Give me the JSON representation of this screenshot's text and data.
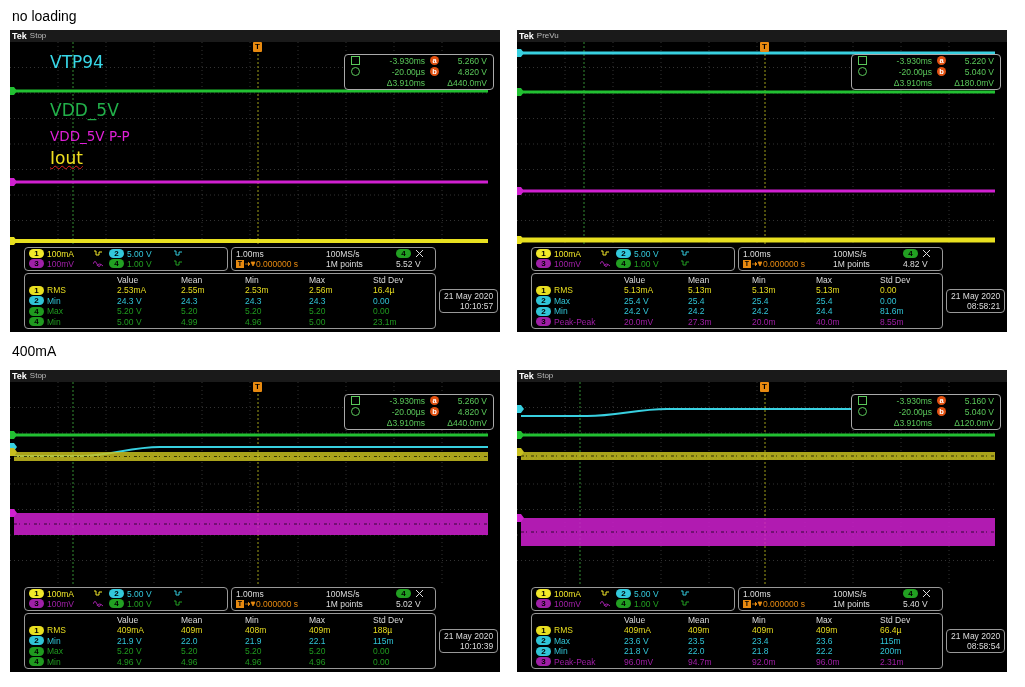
{
  "sections": [
    {
      "heading": "no loading",
      "scopes": [
        {
          "brand": "Tek",
          "status": "Stop",
          "trigger_marker": "T",
          "annotations": [
            {
              "text": "VTP94",
              "color": "#38d6e6",
              "spellcheck": false
            },
            {
              "text": "VDD_5V",
              "color": "#22b04a",
              "spellcheck": false
            },
            {
              "text": "VDD_5V P-P",
              "color": "#e020d8",
              "spellcheck": false
            },
            {
              "text": "Iout",
              "color": "#f0e020",
              "spellcheck": true
            }
          ],
          "cursors": {
            "a_time": "-3.930ms",
            "a_label": "a",
            "a_value": "5.260 V",
            "b_time": "-20.00µs",
            "b_label": "b",
            "b_value": "4.820 V",
            "delta_time": "Δ3.910ms",
            "delta_value": "Δ440.0mV"
          },
          "channels": [
            {
              "number": "1",
              "scale": "100mA",
              "color": "#f2e82a"
            },
            {
              "number": "2",
              "scale": "5.00 V",
              "color": "#33c9dc"
            },
            {
              "number": "3",
              "scale": "100mV",
              "color": "#a020a8"
            },
            {
              "number": "4",
              "scale": "1.00 V",
              "color": "#22a022"
            }
          ],
          "horizontal": {
            "scale": "1.00ms",
            "sample_rate": "100MS/s",
            "trigger_badge": "T",
            "trigger_position": "0.000000 s",
            "record_length": "1M points",
            "trigger_source": "4",
            "trigger_level": "5.52 V"
          },
          "measurements": {
            "columns": [
              "Value",
              "Mean",
              "Min",
              "Max",
              "Std Dev"
            ],
            "rows": [
              {
                "channel": "1",
                "color": "#e8de20",
                "type": "RMS",
                "cells": [
                  "2.53mA",
                  "2.55m",
                  "2.53m",
                  "2.56m",
                  "16.4µ"
                ]
              },
              {
                "channel": "2",
                "color": "#30c4d6",
                "type": "Min",
                "cells": [
                  "24.3 V",
                  "24.3",
                  "24.3",
                  "24.3",
                  "0.00"
                ]
              },
              {
                "channel": "4",
                "color": "#1f9a1f",
                "type": "Max",
                "cells": [
                  "5.20 V",
                  "5.20",
                  "5.20",
                  "5.20",
                  "0.00"
                ]
              },
              {
                "channel": "4",
                "color": "#1f9a1f",
                "type": "Min",
                "cells": [
                  "5.00 V",
                  "4.99",
                  "4.96",
                  "5.00",
                  "23.1m"
                ]
              }
            ]
          },
          "date": "21 May 2020",
          "time": "10:10:57"
        },
        {
          "brand": "Tek",
          "status": "PreVu",
          "trigger_marker": "T",
          "cursors": {
            "a_time": "-3.930ms",
            "a_label": "a",
            "a_value": "5.220 V",
            "b_time": "-20.00µs",
            "b_label": "b",
            "b_value": "5.040 V",
            "delta_time": "Δ3.910ms",
            "delta_value": "Δ180.0mV"
          },
          "channels": [
            {
              "number": "1",
              "scale": "100mA",
              "color": "#f2e82a"
            },
            {
              "number": "2",
              "scale": "5.00 V",
              "color": "#33c9dc"
            },
            {
              "number": "3",
              "scale": "100mV",
              "color": "#a020a8"
            },
            {
              "number": "4",
              "scale": "1.00 V",
              "color": "#22a022"
            }
          ],
          "horizontal": {
            "scale": "1.00ms",
            "sample_rate": "100MS/s",
            "trigger_badge": "T",
            "trigger_position": "0.000000 s",
            "record_length": "1M points",
            "trigger_source": "4",
            "trigger_level": "4.82 V"
          },
          "measurements": {
            "columns": [
              "Value",
              "Mean",
              "Min",
              "Max",
              "Std Dev"
            ],
            "rows": [
              {
                "channel": "1",
                "color": "#e8de20",
                "type": "RMS",
                "cells": [
                  "5.13mA",
                  "5.13m",
                  "5.13m",
                  "5.13m",
                  "0.00"
                ]
              },
              {
                "channel": "2",
                "color": "#30c4d6",
                "type": "Max",
                "cells": [
                  "25.4 V",
                  "25.4",
                  "25.4",
                  "25.4",
                  "0.00"
                ]
              },
              {
                "channel": "2",
                "color": "#30c4d6",
                "type": "Min",
                "cells": [
                  "24.2 V",
                  "24.2",
                  "24.2",
                  "24.4",
                  "81.6m"
                ]
              },
              {
                "channel": "3",
                "color": "#a01ea6",
                "type": "Peak-Peak",
                "cells": [
                  "20.0mV",
                  "27.3m",
                  "20.0m",
                  "40.0m",
                  "8.55m"
                ]
              }
            ]
          },
          "date": "21 May 2020",
          "time": "08:58:21"
        }
      ]
    },
    {
      "heading": "400mA",
      "scopes": [
        {
          "brand": "Tek",
          "status": "Stop",
          "trigger_marker": "T",
          "cursors": {
            "a_time": "-3.930ms",
            "a_label": "a",
            "a_value": "5.260 V",
            "b_time": "-20.00µs",
            "b_label": "b",
            "b_value": "4.820 V",
            "delta_time": "Δ3.910ms",
            "delta_value": "Δ440.0mV"
          },
          "channels": [
            {
              "number": "1",
              "scale": "100mA",
              "color": "#f2e82a"
            },
            {
              "number": "2",
              "scale": "5.00 V",
              "color": "#33c9dc"
            },
            {
              "number": "3",
              "scale": "100mV",
              "color": "#a020a8"
            },
            {
              "number": "4",
              "scale": "1.00 V",
              "color": "#22a022"
            }
          ],
          "horizontal": {
            "scale": "1.00ms",
            "sample_rate": "100MS/s",
            "trigger_badge": "T",
            "trigger_position": "0.000000 s",
            "record_length": "1M points",
            "trigger_source": "4",
            "trigger_level": "5.02 V"
          },
          "measurements": {
            "columns": [
              "Value",
              "Mean",
              "Min",
              "Max",
              "Std Dev"
            ],
            "rows": [
              {
                "channel": "1",
                "color": "#e8de20",
                "type": "RMS",
                "cells": [
                  "409mA",
                  "409m",
                  "408m",
                  "409m",
                  "188µ"
                ]
              },
              {
                "channel": "2",
                "color": "#30c4d6",
                "type": "Min",
                "cells": [
                  "21.9 V",
                  "22.0",
                  "21.9",
                  "22.1",
                  "115m"
                ]
              },
              {
                "channel": "4",
                "color": "#1f9a1f",
                "type": "Max",
                "cells": [
                  "5.20 V",
                  "5.20",
                  "5.20",
                  "5.20",
                  "0.00"
                ]
              },
              {
                "channel": "4",
                "color": "#1f9a1f",
                "type": "Min",
                "cells": [
                  "4.96 V",
                  "4.96",
                  "4.96",
                  "4.96",
                  "0.00"
                ]
              }
            ]
          },
          "date": "21 May 2020",
          "time": "10:10:39"
        },
        {
          "brand": "Tek",
          "status": "Stop",
          "trigger_marker": "T",
          "cursors": {
            "a_time": "-3.930ms",
            "a_label": "a",
            "a_value": "5.160 V",
            "b_time": "-20.00µs",
            "b_label": "b",
            "b_value": "5.040 V",
            "delta_time": "Δ3.910ms",
            "delta_value": "Δ120.0mV"
          },
          "channels": [
            {
              "number": "1",
              "scale": "100mA",
              "color": "#f2e82a"
            },
            {
              "number": "2",
              "scale": "5.00 V",
              "color": "#33c9dc"
            },
            {
              "number": "3",
              "scale": "100mV",
              "color": "#a020a8"
            },
            {
              "number": "4",
              "scale": "1.00 V",
              "color": "#22a022"
            }
          ],
          "horizontal": {
            "scale": "1.00ms",
            "sample_rate": "100MS/s",
            "trigger_badge": "T",
            "trigger_position": "0.000000 s",
            "record_length": "1M points",
            "trigger_source": "4",
            "trigger_level": "5.40 V"
          },
          "measurements": {
            "columns": [
              "Value",
              "Mean",
              "Min",
              "Max",
              "Std Dev"
            ],
            "rows": [
              {
                "channel": "1",
                "color": "#e8de20",
                "type": "RMS",
                "cells": [
                  "409mA",
                  "409m",
                  "409m",
                  "409m",
                  "66.4µ"
                ]
              },
              {
                "channel": "2",
                "color": "#30c4d6",
                "type": "Max",
                "cells": [
                  "23.6 V",
                  "23.5",
                  "23.4",
                  "23.6",
                  "115m"
                ]
              },
              {
                "channel": "2",
                "color": "#30c4d6",
                "type": "Min",
                "cells": [
                  "21.8 V",
                  "22.0",
                  "21.8",
                  "22.2",
                  "200m"
                ]
              },
              {
                "channel": "3",
                "color": "#a01ea6",
                "type": "Peak-Peak",
                "cells": [
                  "96.0mV",
                  "94.7m",
                  "92.0m",
                  "96.0m",
                  "2.31m"
                ]
              }
            ]
          },
          "date": "21 May 2020",
          "time": "08:58:54"
        }
      ]
    }
  ]
}
